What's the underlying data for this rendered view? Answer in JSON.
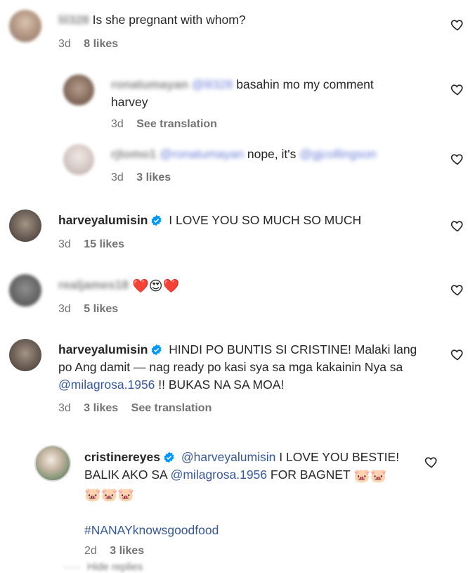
{
  "comments": [
    {
      "username": "lil328",
      "text": "Is she pregnant with whom?",
      "time": "3d",
      "likes": "8 likes"
    },
    {
      "username": "ronatumayan",
      "mention": "@lil328",
      "text_line1": "basahin mo my comment",
      "text_line2": "harvey",
      "time": "3d",
      "action": "See translation"
    },
    {
      "username": "rjtomo1",
      "mention": "@ronatumayan",
      "text": "nope, it's",
      "mention2": "@gjcollingson",
      "time": "3d",
      "likes": "3 likes"
    },
    {
      "username": "harveyalumisin",
      "text": "I LOVE YOU SO MUCH SO MUCH",
      "time": "3d",
      "likes": "15 likes"
    },
    {
      "username": "realjames18",
      "emojis": "❤️😍❤️",
      "time": "3d",
      "likes": "5 likes"
    },
    {
      "username": "harveyalumisin",
      "text_line1": "HINDI PO BUNTIS SI CRISTINE! Malaki lang",
      "text_line2": "po Ang damit — nag ready po kasi sya sa mga kakainin Nya sa",
      "mention": "@milagrosa.1956",
      "text_line3": "!! BUKAS NA SA MOA!",
      "time": "3d",
      "likes": "3 likes",
      "action": "See translation"
    },
    {
      "username": "cristinereyes",
      "mention": "@harveyalumisin",
      "text_line1": "I LOVE YOU BESTIE!",
      "text_line2a": "BALIK AKO SA",
      "mention2": "@milagrosa.1956",
      "text_line2b": "FOR BAGNET",
      "pigs_a": "🐷🐷",
      "pigs_b": "🐷🐷🐷",
      "hashtag": "#NANAYknowsgoodfood",
      "time": "2d",
      "likes": "3 likes"
    }
  ],
  "hidden_replies": "Hide replies",
  "colors": {
    "text": "#262626",
    "meta": "#737373",
    "link": "#385898",
    "verified": "#0095f6"
  }
}
